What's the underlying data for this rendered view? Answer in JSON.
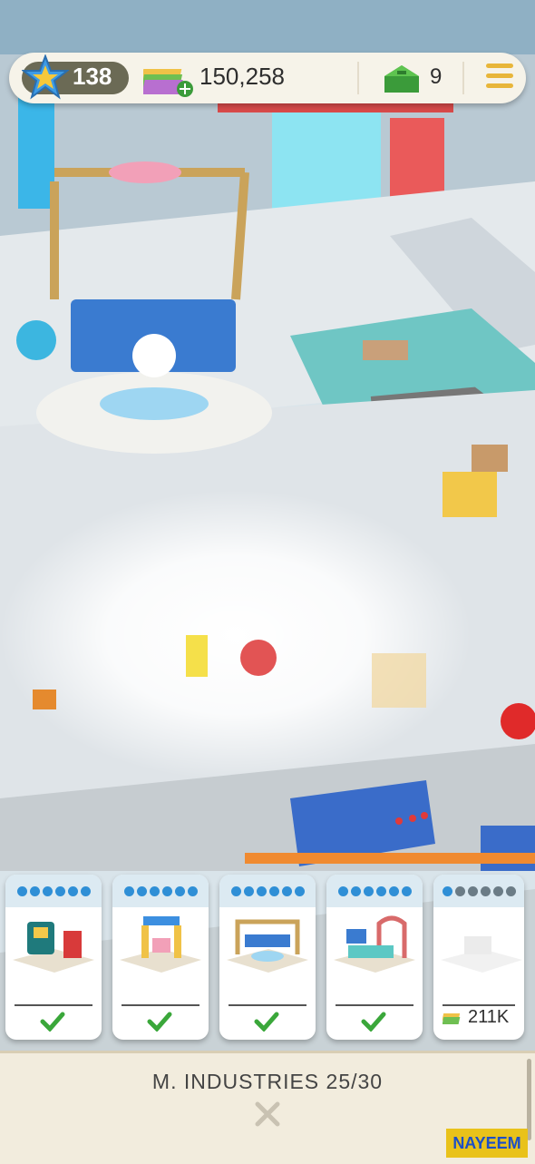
{
  "hud": {
    "level": "138",
    "cash": "150,258",
    "gems": "9",
    "level_icon": "star-badge-icon",
    "cash_icon": "cash-stack-icon",
    "gem_icon": "green-house-icon",
    "menu_icon": "menu-icon"
  },
  "cards": [
    {
      "name": "robot-printer-station",
      "status": "unlocked",
      "progress": 6
    },
    {
      "name": "crane-assembly-station",
      "status": "unlocked",
      "progress": 6
    },
    {
      "name": "robot-display-station",
      "status": "unlocked",
      "progress": 6
    },
    {
      "name": "arch-console-station",
      "status": "unlocked",
      "progress": 6
    },
    {
      "name": "locked-station",
      "status": "locked",
      "progress": 1,
      "price": "211K"
    }
  ],
  "panel": {
    "title": "M. INDUSTRIES 25/30",
    "close_label": "X"
  },
  "watermark": "NAYEEM",
  "colors": {
    "hud_bg": "#f6f3e9",
    "cash_green": "#3b9b3a",
    "check_green": "#3aa73a",
    "dot_blue": "#2f8fd6",
    "panel_bg": "#f2ecdd"
  }
}
